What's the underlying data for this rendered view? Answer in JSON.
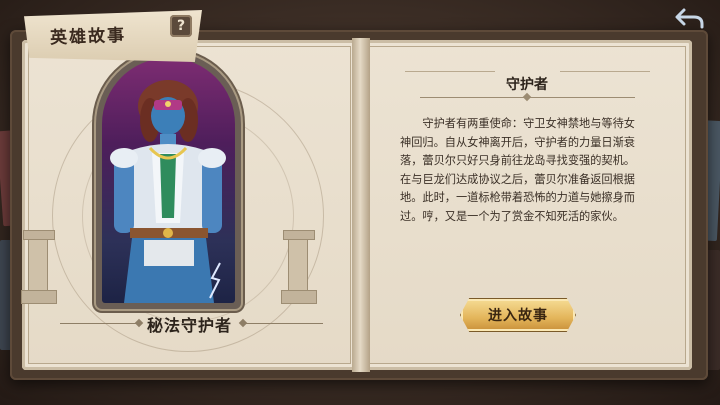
{
  "header": {
    "title": "英雄故事",
    "help_symbol": "?"
  },
  "hero": {
    "name": "秘法守护者"
  },
  "story": {
    "section_title": "守护者",
    "body": "守护者有两重使命：守卫女神禁地与等待女神回归。自从女神离开后，守护者的力量日渐衰落，蕾贝尔只好只身前往龙岛寻找变强的契机。在与巨龙们达成协议之后，蕾贝尔准备返回根据地。此时，一道标枪带着恐怖的力道与她擦身而过。哼，又是一个为了赏金不知死活的家伙。",
    "enter_button": "进入故事"
  },
  "icons": {
    "help": "question-mark-icon",
    "back": "back-arrow-icon"
  },
  "colors": {
    "page": "#ece3d3",
    "button_gold": "#e3b55a",
    "cover": "#4a3a2d"
  }
}
